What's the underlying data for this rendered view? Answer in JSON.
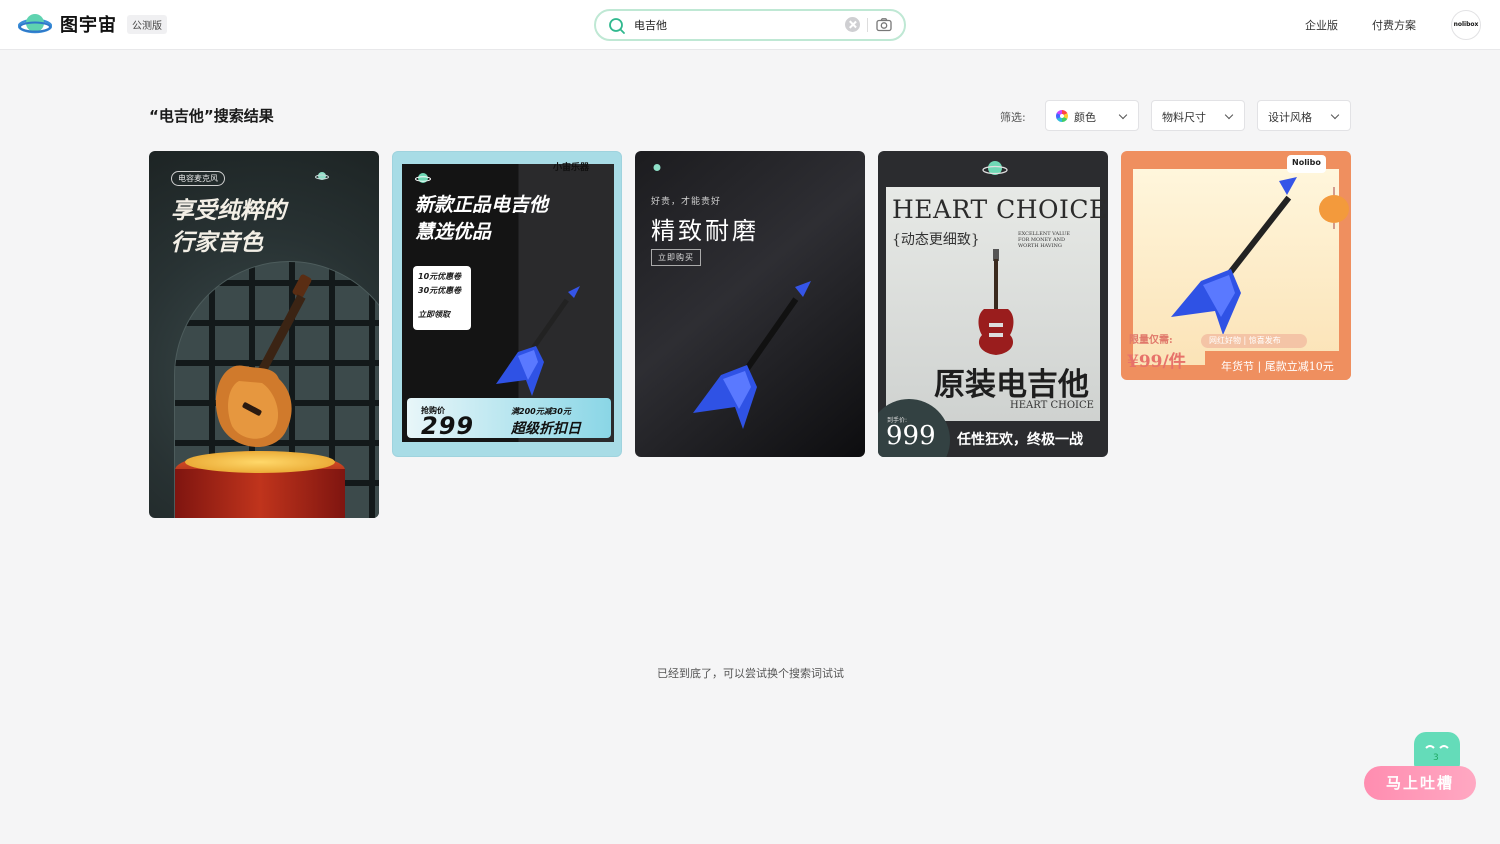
{
  "header": {
    "logo_text": "图宇宙",
    "beta_badge": "公测版",
    "search_value": "电吉他",
    "nav": [
      "企业版",
      "付费方案"
    ],
    "avatar_text": "nolibox"
  },
  "results": {
    "title": "“电吉他”搜索结果",
    "filter_label": "筛选:",
    "filters": [
      "颜色",
      "物料尺寸",
      "设计风格"
    ]
  },
  "cards": [
    {
      "tag": "电容麦克风",
      "title_line1": "享受纯粹的",
      "title_line2": "行家音色"
    },
    {
      "brand": "小宙乐器",
      "title_line1": "新款正品电吉他",
      "title_line2": "慧选优品",
      "coupons": [
        "10元优惠卷",
        "30元优惠卷",
        "立即领取"
      ],
      "price_label": "抢购价",
      "price": "299",
      "deal_line1": "满200元减30元",
      "deal_line2": "超级折扣日"
    },
    {
      "subtitle": "好贵，才能贵好",
      "title": "精致耐磨",
      "button": "立即购买"
    },
    {
      "title": "HEART CHOICE",
      "sub": "{动态更细致}",
      "note": "EXCELLENT VALUE FOR MONEY AND WORTH HAVING",
      "big": "原装电吉他",
      "hc": "HEART CHOICE",
      "price_label": "到手价:",
      "price": "999",
      "slogan": "任性狂欢，终极一战"
    },
    {
      "brand": "Nolibo",
      "limit_label": "限量仅需:",
      "price": "¥99/件",
      "pill": "网红好物 | 惊喜发布",
      "footer": "年货节 | 尾款立减10元"
    }
  ],
  "footer_note": "已经到底了，可以尝试换个搜索词试试",
  "feedback_button": "马上吐槽",
  "colors": {
    "accent": "#64dcb9",
    "search_border": "#bfe8d4",
    "feedback_pink": "#ff8db0"
  }
}
